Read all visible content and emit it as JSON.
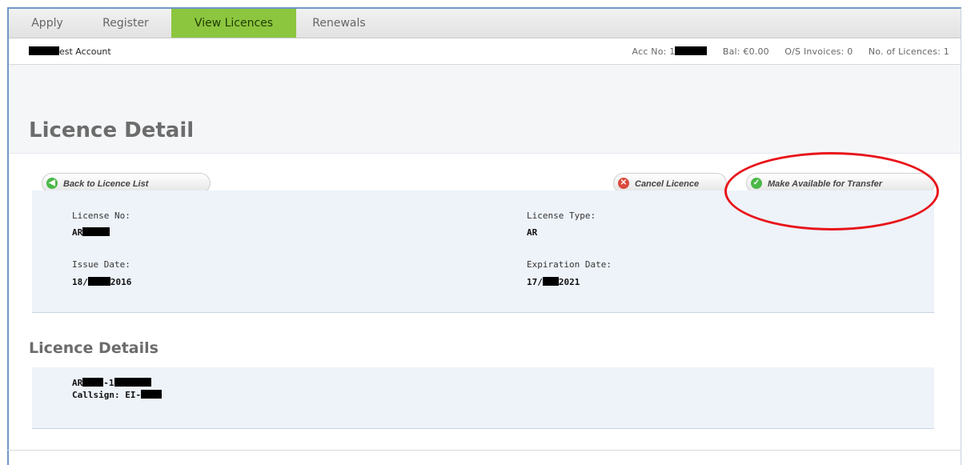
{
  "nav": {
    "tabs": [
      {
        "label": "Apply"
      },
      {
        "label": "Register"
      },
      {
        "label": "View Licences",
        "active": true
      },
      {
        "label": "Renewals"
      }
    ]
  },
  "account": {
    "name_suffix": "est Account",
    "acc_no_label": "Acc No: 1",
    "balance": "Bal: €0.00",
    "invoices": "O/S Invoices: 0",
    "licences": "No. of Licences: 1"
  },
  "page": {
    "title": "Licence Detail",
    "back_button": "Back to Licence List",
    "cancel_button": "Cancel Licence",
    "transfer_button": "Make Available for Transfer"
  },
  "licence": {
    "license_no_label": "License No:",
    "license_no_prefix": "AR",
    "license_type_label": "License Type:",
    "license_type": "AR",
    "issue_date_label": "Issue Date:",
    "issue_date_day": "18/",
    "issue_date_year": "2016",
    "expiration_date_label": "Expiration Date:",
    "expiration_date_day": "17/",
    "expiration_date_year": "2021"
  },
  "details": {
    "section_title": "Licence Details",
    "line1_prefix": "AR",
    "line1_mid": "-1",
    "callsign_label": "Callsign: EI-"
  },
  "colors": {
    "active_tab": "#8cc63f",
    "annotation": "#e8141a",
    "detail_bg": "#eef3fa"
  }
}
